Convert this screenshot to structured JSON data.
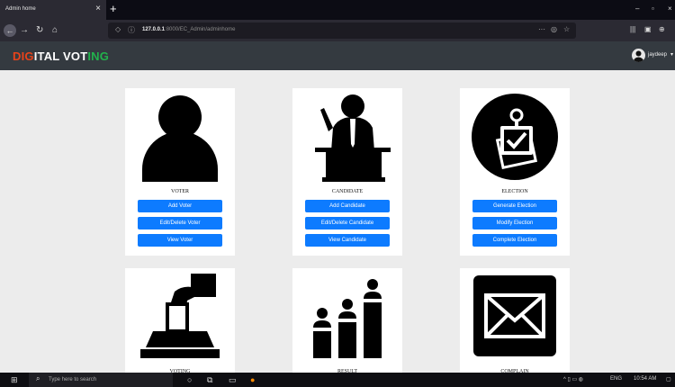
{
  "browser": {
    "tab_title": "Admin home",
    "url_host": "127.0.0.1",
    "url_path": ":8000/EC_Admin/adminhome"
  },
  "app": {
    "brand": {
      "p1": "DIG",
      "p2": "ITAL VOT",
      "p3": "ING"
    },
    "user": {
      "name": "jaydeep"
    }
  },
  "cards": {
    "voter": {
      "title": "VOTER",
      "icon": "person-icon",
      "buttons": [
        "Add Voter",
        "Edit/Delete Voter",
        "View Voter"
      ]
    },
    "candidate": {
      "title": "CANDIDATE",
      "icon": "speaker-podium-icon",
      "buttons": [
        "Add Candidate",
        "Edit/Delete Candidate",
        "View Candidate"
      ]
    },
    "election": {
      "title": "ELECTION",
      "icon": "checklist-icon",
      "buttons": [
        "Generate Election",
        "Modify Election",
        "Complete Election"
      ]
    },
    "voting": {
      "title": "VOTING",
      "icon": "ballot-box-icon"
    },
    "result": {
      "title": "RESULT",
      "icon": "podium-ranking-icon"
    },
    "complain": {
      "title": "COMPLAIN",
      "icon": "envelope-icon"
    }
  },
  "taskbar": {
    "search_placeholder": "Type here to search",
    "lang": "ENG",
    "time": "10:54 AM"
  },
  "colors": {
    "brand_red": "#e8431a",
    "brand_white": "#ffffff",
    "brand_green": "#22b24c",
    "button_blue": "#0d7bff",
    "header_bg": "#343a40"
  }
}
